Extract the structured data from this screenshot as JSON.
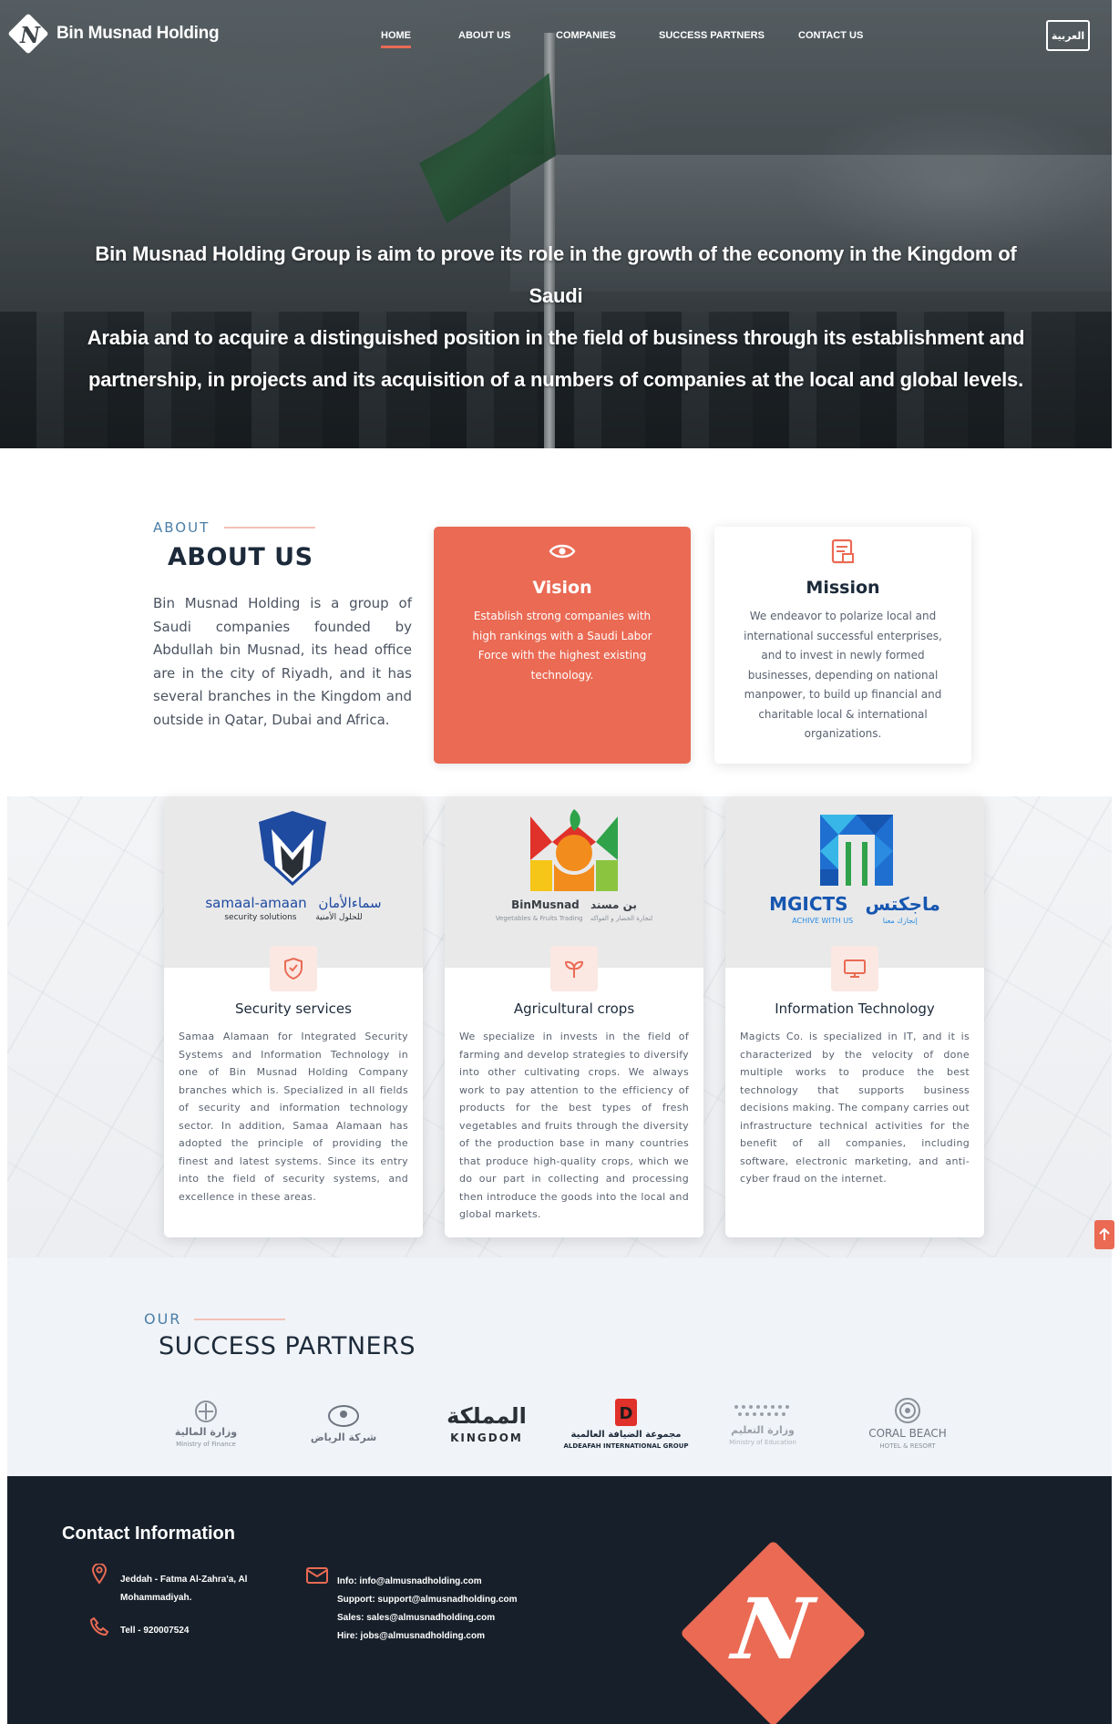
{
  "header": {
    "brand": "Bin Musnad Holding",
    "nav": [
      {
        "label": "HOME",
        "active": true
      },
      {
        "label": "ABOUT US",
        "active": false
      },
      {
        "label": "COMPANIES",
        "active": false
      },
      {
        "label": "SUCCESS PARTNERS",
        "active": false
      },
      {
        "label": "CONTACT US",
        "active": false
      }
    ],
    "language_button": "العربية"
  },
  "hero": {
    "line1": "Bin Musnad Holding Group is aim to prove its role in the growth of the economy in the Kingdom of Saudi",
    "line2": "Arabia and to acquire a distinguished position in the field of business through its establishment and",
    "line3": "partnership, in projects and its acquisition of a numbers of companies at the local and global levels."
  },
  "about": {
    "eyebrow": "ABOUT",
    "title": "ABOUT US",
    "text": "Bin Musnad Holding is a group of Saudi companies founded by Abdullah bin Musnad, its head office are in the city of Riyadh, and it has several branches in the Kingdom and outside in Qatar, Dubai and Africa.",
    "vision": {
      "icon": "eye-icon",
      "title": "Vision",
      "text": "Establish strong companies with high rankings with a Saudi Labor Force with the highest existing technology."
    },
    "mission": {
      "icon": "document-icon",
      "title": "Mission",
      "text": "We endeavor to polarize local and international successful enterprises, and to invest in newly formed businesses, depending on national manpower, to build up financial and charitable local & international organizations."
    }
  },
  "services": [
    {
      "logo_text_en": "samaal-amaan",
      "logo_text_ar": "سماءالأمان",
      "logo_sub_en": "security solutions",
      "logo_sub_ar": "للحلول الأمنية",
      "icon": "shield-check-icon",
      "title": "Security services",
      "text": "Samaa Alamaan for Integrated Security Systems and Information Technology in one of Bin Musnad Holding Company branches which is. Specialized in all fields of security and information technology sector. In addition, Samaa Alamaan has adopted the principle of providing the finest and latest systems. Since its entry into the field of security systems, and excellence in these areas."
    },
    {
      "logo_text_en": "BinMusnad",
      "logo_text_ar": "بن مسند",
      "logo_sub_en": "Vegetables & Fruits Trading",
      "logo_sub_ar": "لتجارة الخضار و الفواكه",
      "icon": "sprout-icon",
      "title": "Agricultural crops",
      "text": "We specialize in invests in the field of farming and develop strategies to diversify into other cultivating crops. We always work to pay attention to the efficiency of products for the best types of fresh vegetables and fruits through the diversity of the production base in many countries that produce high-quality crops, which we do our part in collecting and processing then introduce the goods into the local and global markets."
    },
    {
      "logo_text_en": "MGICTS",
      "logo_text_ar": "ماجكتس",
      "logo_sub_en": "ACHIVE WITH US",
      "logo_sub_ar": "إنجازك معنا",
      "icon": "monitor-icon",
      "title": "Information Technology",
      "text": "Magicts Co. is specialized in IT, and it is characterized by the velocity of done multiple works to produce the best technology that supports business decisions making. The company carries out infrastructure technical activities for the benefit of all companies, including software, electronic marketing, and anti-cyber fraud on the internet."
    }
  ],
  "partners": {
    "eyebrow": "OUR",
    "title": "SUCCESS PARTNERS",
    "items": [
      {
        "label": "وزارة المالية",
        "sub": "Ministry of Finance"
      },
      {
        "label": "شركة الرياض",
        "sub": ""
      },
      {
        "label": "المملكة",
        "sub": "KINGDOM"
      },
      {
        "label": "مجموعة الضيافة العالمية",
        "sub": "ALDEAFAH INTERNATIONAL GROUP"
      },
      {
        "label": "وزارة التعليم",
        "sub": "Ministry of Education"
      },
      {
        "label": "CORAL BEACH",
        "sub": "HOTEL & RESORT"
      }
    ]
  },
  "footer": {
    "title": "Contact Information",
    "address_line1": "Jeddah - Fatma Al-Zahra'a, Al",
    "address_line2": "Mohammadiyah.",
    "phone": "Tell - 920007524",
    "emails": [
      "Info: info@almusnadholding.com",
      "Support: support@almusnadholding.com",
      "Sales: sales@almusnadholding.com",
      "Hire: jobs@almusnadholding.com"
    ]
  },
  "colors": {
    "accent": "#ea6a54",
    "footer_bg": "#17202a",
    "heading": "#1c2a3a",
    "eyebrow": "#4a7ea8"
  }
}
